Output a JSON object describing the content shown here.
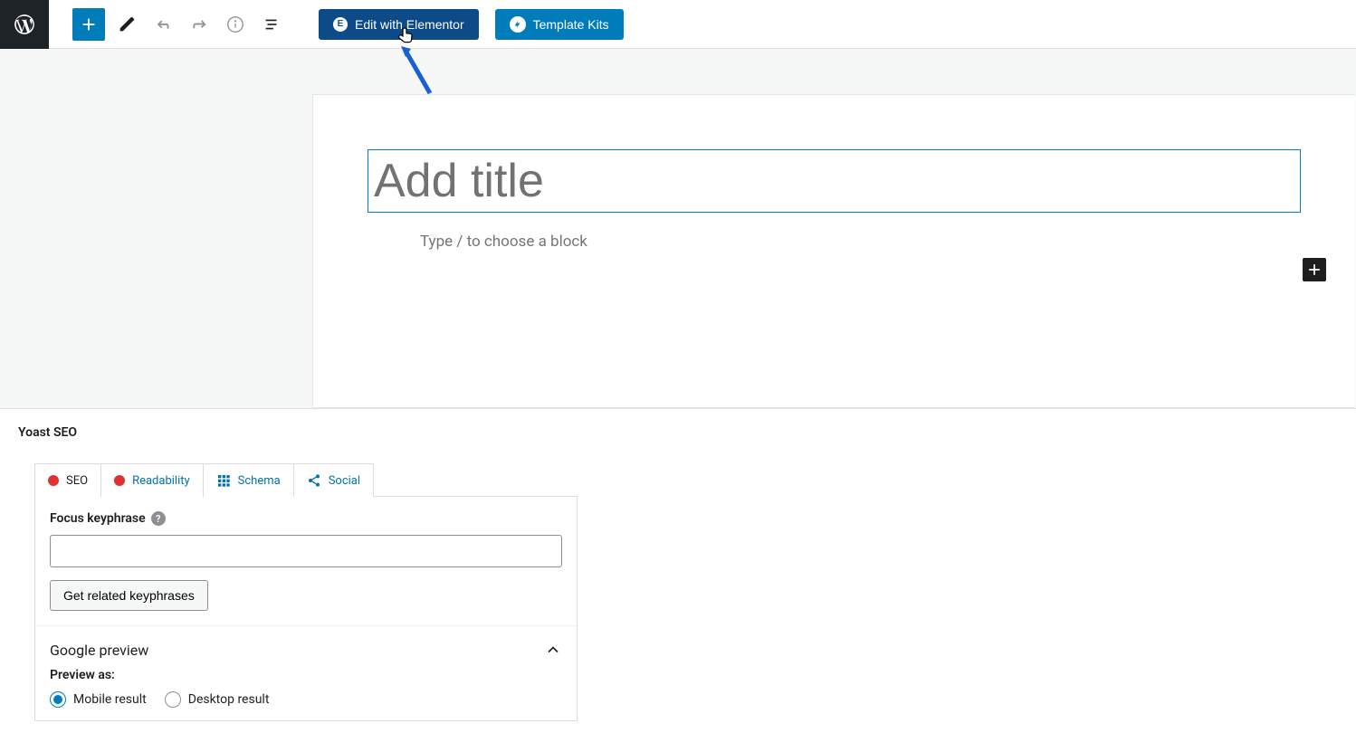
{
  "toolbar": {
    "edit_with_elementor": "Edit with Elementor",
    "template_kits": "Template Kits"
  },
  "editor": {
    "title_placeholder": "Add title",
    "block_prompt": "Type / to choose a block"
  },
  "yoast": {
    "panel_title": "Yoast SEO",
    "tabs": {
      "seo": "SEO",
      "readability": "Readability",
      "schema": "Schema",
      "social": "Social"
    },
    "focus_label": "Focus keyphrase",
    "related_button": "Get related keyphrases",
    "google_preview": "Google preview",
    "preview_as": "Preview as:",
    "mobile_result": "Mobile result",
    "desktop_result": "Desktop result"
  }
}
